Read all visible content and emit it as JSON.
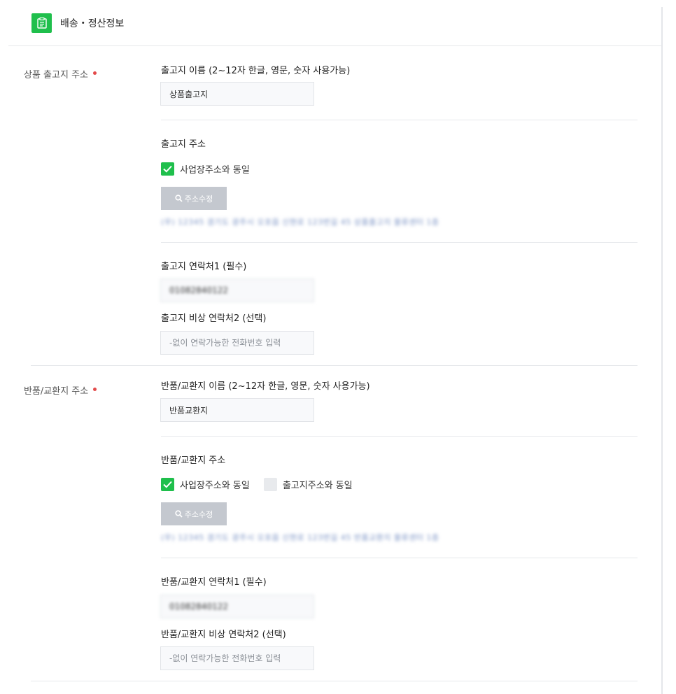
{
  "header": {
    "title": "배송・정산정보",
    "icon": "clipboard-icon",
    "accent_color": "#1fbf4c"
  },
  "shipping": {
    "section_label": "상품 출고지 주소",
    "name_label": "출고지 이름 (2~12자 한글, 영문, 숫자 사용가능)",
    "name_value": "상품출고지",
    "address_label": "출고지 주소",
    "same_as_business_label": "사업장주소와 동일",
    "same_as_business_checked": true,
    "edit_address_button": "주소수정",
    "address_text": "(우) 12345 경기도 광주시 오포읍 신현로 123번길 45 상품출고지 물류센터 1층",
    "contact1_label": "출고지 연락처1 (필수)",
    "contact1_value": "01082840122",
    "contact2_label": "출고지 비상 연락처2 (선택)",
    "contact2_placeholder": "-없이 연락가능한 전화번호 입력"
  },
  "returns": {
    "section_label": "반품/교환지 주소",
    "name_label": "반품/교환지 이름 (2~12자 한글, 영문, 숫자 사용가능)",
    "name_value": "반품교환지",
    "address_label": "반품/교환지 주소",
    "same_as_business_label": "사업장주소와 동일",
    "same_as_business_checked": true,
    "same_as_shipping_label": "출고지주소와 동일",
    "same_as_shipping_checked": false,
    "edit_address_button": "주소수정",
    "address_text": "(우) 12345 경기도 광주시 오포읍 신현로 123번길 45 반품교환지 물류센터 1층",
    "contact1_label": "반품/교환지 연락처1 (필수)",
    "contact1_value": "01082840122",
    "contact2_label": "반품/교환지 비상 연락처2 (선택)",
    "contact2_placeholder": "-없이 연락가능한 전화번호 입력"
  }
}
